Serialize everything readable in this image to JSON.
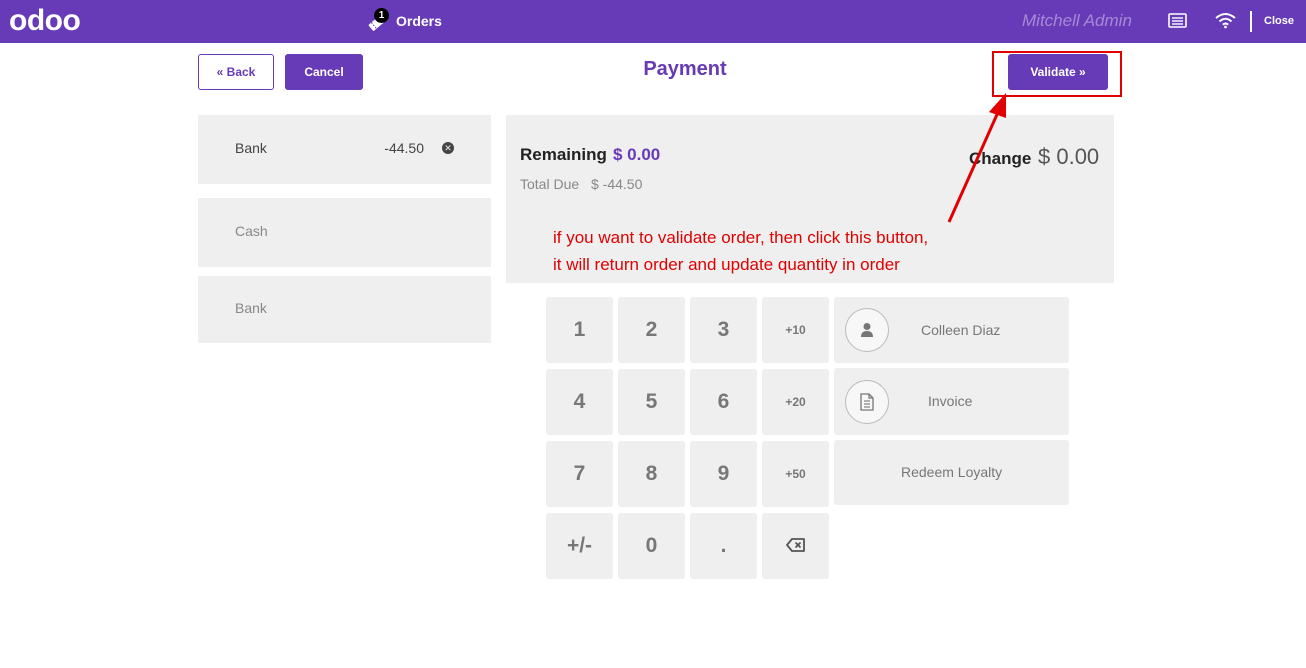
{
  "topbar": {
    "logo": "odoo",
    "orders_label": "Orders",
    "orders_count": "1",
    "user": "Mitchell Admin",
    "close_label": "Close",
    "icons": [
      "ticket-icon",
      "cashbox-icon",
      "wifi-icon"
    ]
  },
  "header": {
    "back_label": "« Back",
    "cancel_label": "Cancel",
    "title": "Payment",
    "validate_label": "Validate »"
  },
  "payment_lines": [
    {
      "name": "Bank",
      "amount": "-44.50"
    }
  ],
  "payment_methods": [
    "Cash",
    "Bank"
  ],
  "summary": {
    "remaining_label": "Remaining",
    "remaining_value": "$ 0.00",
    "total_due_label": "Total Due",
    "total_due_value": "$ -44.50",
    "change_label": "Change",
    "change_value": "$ 0.00"
  },
  "annotation": {
    "line1": "if you want to validate order, then click this button,",
    "line2": "it will return order and update quantity in order"
  },
  "numpad": {
    "k1": "1",
    "k2": "2",
    "k3": "3",
    "p10": "+10",
    "k4": "4",
    "k5": "5",
    "k6": "6",
    "p20": "+20",
    "k7": "7",
    "k8": "8",
    "k9": "9",
    "p50": "+50",
    "sign": "+/-",
    "k0": "0",
    "dot": "."
  },
  "actions": {
    "customer": "Colleen Diaz",
    "invoice": "Invoice",
    "loyalty": "Redeem Loyalty"
  },
  "colors": {
    "brand": "#673ab7",
    "annotation": "#e00000",
    "panel": "#efefef"
  }
}
